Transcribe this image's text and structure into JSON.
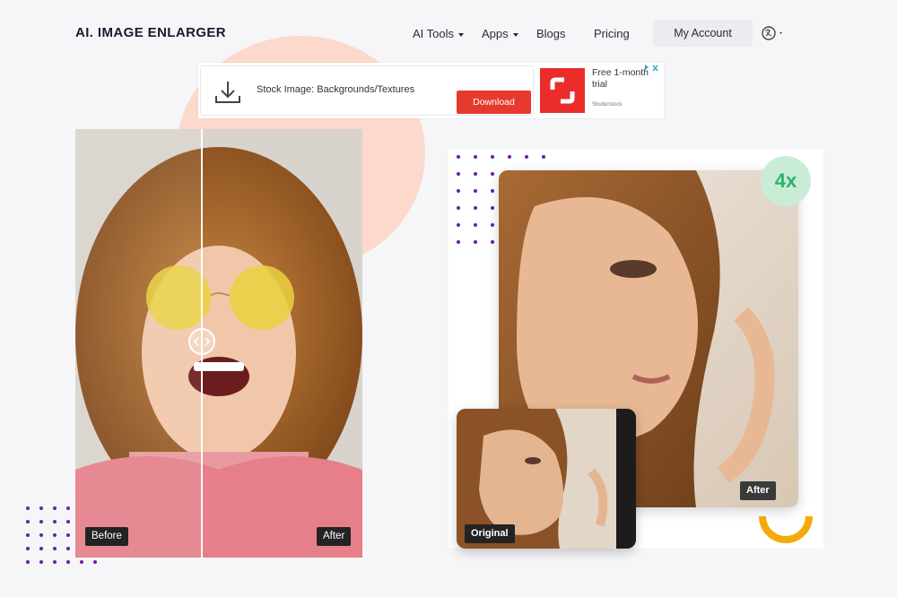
{
  "header": {
    "logo": "AI. IMAGE ENLARGER",
    "nav": [
      {
        "label": "AI Tools",
        "has_caret": true
      },
      {
        "label": "Apps",
        "has_caret": true
      },
      {
        "label": "Blogs",
        "has_caret": false
      },
      {
        "label": "Pricing",
        "has_caret": false
      }
    ],
    "account_label": "My Account",
    "language_icon": "translate-icon"
  },
  "ad": {
    "text": "Stock Image: Backgrounds/Textures",
    "button_label": "Download",
    "offer": "Free 1-month trial",
    "brand": "Shutterstock",
    "icon": "download-icon",
    "colors": {
      "button": "#e63a2f",
      "logo": "#ea2d2a"
    }
  },
  "compare": {
    "before_label": "Before",
    "after_label": "After"
  },
  "showcase": {
    "badge": "4x",
    "after_label": "After",
    "original_label": "Original",
    "colors": {
      "badge_bg": "#c9ecd7",
      "badge_text": "#28b56a",
      "ring": "#f5a90b",
      "dots": "#6a1fa7"
    }
  }
}
